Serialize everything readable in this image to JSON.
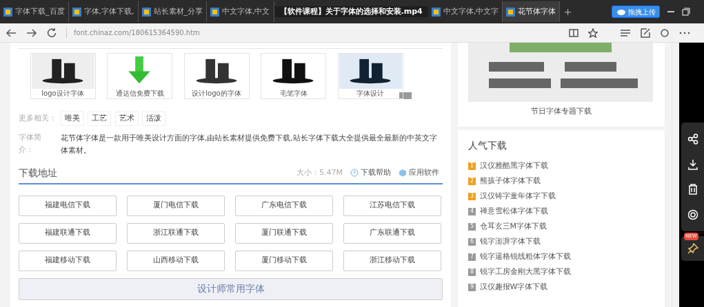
{
  "video_title": "【软件课程】关于字体的选择和安装.mp4",
  "tabs": [
    {
      "label": "字体下载_百度",
      "selected": false
    },
    {
      "label": "字体,字体下载,",
      "selected": false
    },
    {
      "label": "站长素材_分享",
      "selected": false
    },
    {
      "label": "中文字体,中文",
      "selected": false
    },
    {
      "label": "中文字体,中文字",
      "selected": false
    },
    {
      "label": "花节体字体",
      "selected": true
    }
  ],
  "new_tab_button": "+",
  "upload_button": "拖拽上传",
  "address": "font.chinaz.com/180615364590.htm",
  "thumbnails": [
    {
      "caption": "logo设计字体"
    },
    {
      "caption": "通达信免费下载"
    },
    {
      "caption": "设计logo的字体"
    },
    {
      "caption": "毛笔字体"
    },
    {
      "caption": "字体设计"
    }
  ],
  "related": {
    "label": "更多相关：",
    "tags": [
      "唯美",
      "工艺",
      "艺术",
      "活泼"
    ]
  },
  "intro": {
    "label": "字体简介：",
    "text": "花节体字体是一款用于唯美设计方面的字体,由站长素材提供免费下载,站长字体下载大全提供最全最新的中英文字体素材。"
  },
  "download": {
    "title": "下载地址",
    "size": "大小：5.47M",
    "help": "下载帮助",
    "software": "应用软件",
    "buttons": [
      "福建电信下载",
      "厦门电信下载",
      "广东电信下载",
      "江苏电信下载",
      "福建联通下载",
      "浙江联通下载",
      "厦门联通下载",
      "广东联通下载",
      "福建移动下载",
      "山西移动下载",
      "厦门移动下载",
      "浙江移动下载"
    ],
    "wide_button": "设计师常用字体"
  },
  "banner": {
    "caption": "节日字体专题下载"
  },
  "popular": {
    "title": "人气下载",
    "items": [
      {
        "rank": "1",
        "name": "汉仪雅酷黑字体下载",
        "color": "#f0a020"
      },
      {
        "rank": "2",
        "name": "熊孩子体字体下载",
        "color": "#f0a020"
      },
      {
        "rank": "3",
        "name": "汉仪铸字童年体字下载",
        "color": "#f0a020"
      },
      {
        "rank": "4",
        "name": "禅意雪松体字体下载",
        "color": "#999999"
      },
      {
        "rank": "5",
        "name": "仓耳玄三M字体下载",
        "color": "#999999"
      },
      {
        "rank": "6",
        "name": "锐字澎湃字体下载",
        "color": "#999999"
      },
      {
        "rank": "7",
        "name": "锐字逼格锐线粗体字体下载",
        "color": "#999999"
      },
      {
        "rank": "8",
        "name": "锐字工房金刚大黑字体下载",
        "color": "#999999"
      },
      {
        "rank": "9",
        "name": "汉仪趣报W字体下载",
        "color": "#999999"
      }
    ]
  },
  "side_badge": "NEW"
}
